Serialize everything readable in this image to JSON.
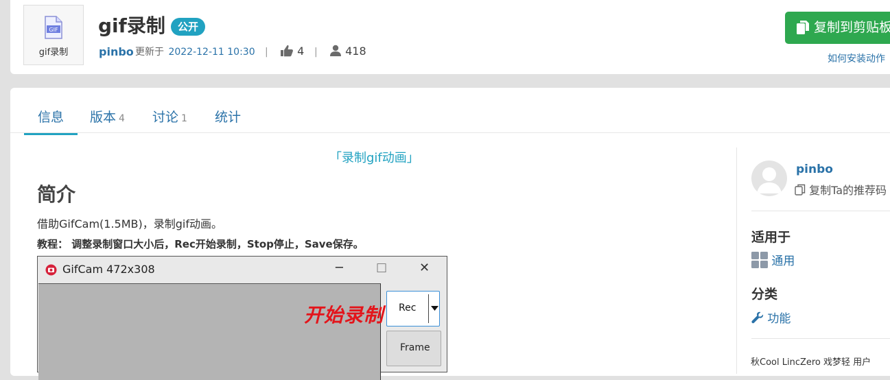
{
  "header": {
    "icon_label": "gif录制",
    "icon_badge": "GIF",
    "title": "gif录制",
    "badge": "公开",
    "author": "pinbo",
    "updated_label": "更新于",
    "updated_time": "2022-12-11 10:30",
    "likes": "4",
    "users": "418",
    "separator": "|",
    "copy_button": "复制到剪贴板",
    "install_link": "如何安装动作"
  },
  "tabs": [
    {
      "label": "信息",
      "count": ""
    },
    {
      "label": "版本",
      "count": "4"
    },
    {
      "label": "讨论",
      "count": "1"
    },
    {
      "label": "统计",
      "count": ""
    }
  ],
  "content": {
    "link": "「录制gif动画」",
    "section_title": "简介",
    "desc1": "借助GifCam(1.5MB)，录制gif动画。",
    "desc2": "教程： 调整录制窗口大小后，Rec开始录制，Stop停止，Save保存。"
  },
  "gifcam": {
    "title": "GifCam 472x308",
    "minimize": "─",
    "maximize": "□",
    "close": "✕",
    "caption": "开始录制",
    "rec_label": "Rec",
    "frame_label": "Frame"
  },
  "sidebar": {
    "author": "pinbo",
    "copy_text": "复制Ta的推荐码",
    "applies_heading": "适用于",
    "applies_item": "通用",
    "category_heading": "分类",
    "category_item": "功能",
    "footer": "秋Cool LincZero 戏梦轻 用户"
  },
  "colors": {
    "accent": "#21a2c1",
    "link": "#2a72a8",
    "button_green": "#2ea84f",
    "caption_red": "#e3151b"
  }
}
